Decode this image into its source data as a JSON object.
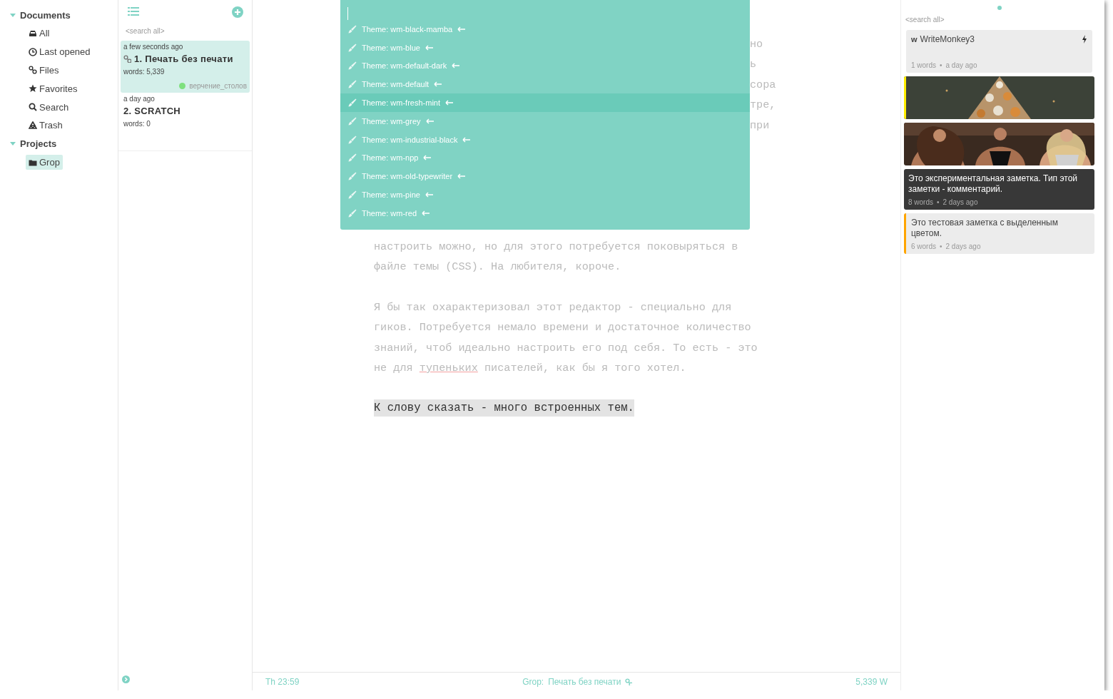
{
  "sidebar": {
    "sections": [
      {
        "label": "Documents",
        "expanded": true,
        "items": [
          {
            "label": "All",
            "selected": false
          },
          {
            "label": "Last opened",
            "selected": false
          },
          {
            "label": "Files",
            "selected": false
          },
          {
            "label": "Favorites",
            "selected": false
          },
          {
            "label": "Search",
            "selected": false
          },
          {
            "label": "Trash",
            "selected": false
          }
        ]
      },
      {
        "label": "Projects",
        "expanded": true,
        "items": [
          {
            "label": "Grop",
            "selected": true
          }
        ]
      }
    ]
  },
  "notes": {
    "search": {
      "placeholder": "<search all>"
    },
    "items": [
      {
        "time": "a few seconds ago",
        "title": "1. Печать без печати",
        "linked": true,
        "words": "words: 5,339",
        "tag": {
          "label": "верчение_столов",
          "color": "#7ee07e"
        },
        "selected": true
      },
      {
        "time": "a day ago",
        "title": "2. SCRATCH",
        "linked": false,
        "words": "words: 0",
        "selected": false
      }
    ]
  },
  "editor": {
    "fragments": [
      "но",
      "ь",
      "сора",
      "тре,",
      "при"
    ],
    "paragraphs": [
      {
        "lines": [
          "настроить можно, но для этого потребуется поковыряться в",
          "файле темы (CSS). На любителя, короче."
        ],
        "highlighted": false
      },
      {
        "lines": [
          "Я бы так охарактеризовал этот редактор - специально для",
          "гиков. Потребуется немало времени и достаточное количество",
          "знаний, чтоб идеально настроить его под себя. То есть - это",
          "не для *тупеньких* писателей, как бы я того хотел."
        ],
        "highlighted": false
      },
      {
        "lines": [
          "К слову сказать - много встроенных тем."
        ],
        "highlighted": true
      }
    ]
  },
  "palette": {
    "items": [
      {
        "label": "Theme: wm-black-mamba",
        "selected": false
      },
      {
        "label": "Theme: wm-blue",
        "selected": false
      },
      {
        "label": "Theme: wm-default-dark",
        "selected": false
      },
      {
        "label": "Theme: wm-default",
        "selected": false
      },
      {
        "label": "Theme: wm-fresh-mint",
        "selected": true
      },
      {
        "label": "Theme: wm-grey",
        "selected": false
      },
      {
        "label": "Theme: wm-industrial-black",
        "selected": false
      },
      {
        "label": "Theme: wm-npp",
        "selected": false
      },
      {
        "label": "Theme: wm-old-typewriter",
        "selected": false
      },
      {
        "label": "Theme: wm-pine",
        "selected": false
      },
      {
        "label": "Theme: wm-red",
        "selected": false
      }
    ]
  },
  "status_bar": {
    "time": "Th 23:59",
    "project": "Grop:",
    "document": "Печать без печати",
    "count": "5,339 W"
  },
  "right_panel": {
    "search": {
      "placeholder": "<search all>"
    },
    "cards": [
      {
        "kind": "note",
        "prefix": "w",
        "title": "WriteMonkey3",
        "words": "1 words",
        "separator": "•",
        "age": "a day ago"
      },
      {
        "kind": "picture",
        "color": "#ffee00"
      },
      {
        "kind": "picture"
      },
      {
        "kind": "dark",
        "text": "Это экспериментальная заметка. Тип этой заметки - комментарий.",
        "words": "8 words",
        "separator": "•",
        "age": "2 days ago"
      },
      {
        "kind": "plain",
        "text": "Это тестовая заметка с выделенным цветом.",
        "words": "6 words",
        "separator": "•",
        "age": "2 days ago",
        "color": "#ffa500"
      }
    ]
  }
}
